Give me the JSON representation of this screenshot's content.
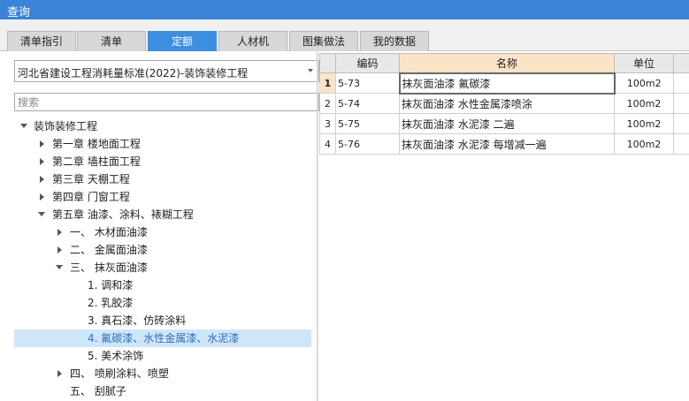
{
  "window": {
    "title": "查询"
  },
  "tabs": [
    {
      "label": "清单指引",
      "active": false
    },
    {
      "label": "清单",
      "active": false
    },
    {
      "label": "定额",
      "active": true
    },
    {
      "label": "人材机",
      "active": false
    },
    {
      "label": "图集做法",
      "active": false
    },
    {
      "label": "我的数据",
      "active": false
    }
  ],
  "colors": {
    "title_bar": "#3b83d6",
    "active_tab": "#3d8ee0",
    "selected_row": "#cfe6f8",
    "header_highlight": "#fbe4c6"
  },
  "left_panel": {
    "standard_select": {
      "value": "河北省建设工程消耗量标准(2022)-装饰装修工程"
    },
    "search": {
      "placeholder": "搜索",
      "value": ""
    },
    "tree": [
      {
        "label": "装饰装修工程",
        "toggle": "expanded"
      },
      {
        "label": "第一章 楼地面工程",
        "toggle": "collapsed"
      },
      {
        "label": "第二章 墙柱面工程",
        "toggle": "collapsed"
      },
      {
        "label": "第三章 天棚工程",
        "toggle": "collapsed"
      },
      {
        "label": "第四章 门窗工程",
        "toggle": "collapsed"
      },
      {
        "label": "第五章 油漆、涂料、裱糊工程",
        "toggle": "expanded"
      },
      {
        "label": "一、 木材面油漆",
        "toggle": "collapsed"
      },
      {
        "label": "二、 金属面油漆",
        "toggle": "collapsed"
      },
      {
        "label": "三、 抹灰面油漆",
        "toggle": "expanded"
      },
      {
        "label": "1. 调和漆",
        "toggle": "none"
      },
      {
        "label": "2. 乳胶漆",
        "toggle": "none"
      },
      {
        "label": "3. 真石漆、仿砖涂料",
        "toggle": "none"
      },
      {
        "label": "4. 氟碳漆、水性金属漆、水泥漆",
        "toggle": "none",
        "selected": true
      },
      {
        "label": "5. 美术涂饰",
        "toggle": "none"
      },
      {
        "label": "四、 喷刷涂料、喷塑",
        "toggle": "collapsed"
      },
      {
        "label": "五、 刮腻子",
        "toggle": "none"
      }
    ]
  },
  "grid": {
    "columns": {
      "code": "编码",
      "name": "名称",
      "unit": "单位"
    },
    "rows": [
      {
        "num": "1",
        "code": "5-73",
        "name": "抹灰面油漆 氟碳漆",
        "unit": "100m2",
        "current": true
      },
      {
        "num": "2",
        "code": "5-74",
        "name": "抹灰面油漆 水性金属漆喷涂",
        "unit": "100m2"
      },
      {
        "num": "3",
        "code": "5-75",
        "name": "抹灰面油漆 水泥漆 二遍",
        "unit": "100m2"
      },
      {
        "num": "4",
        "code": "5-76",
        "name": "抹灰面油漆 水泥漆 每增减一遍",
        "unit": "100m2"
      }
    ]
  }
}
